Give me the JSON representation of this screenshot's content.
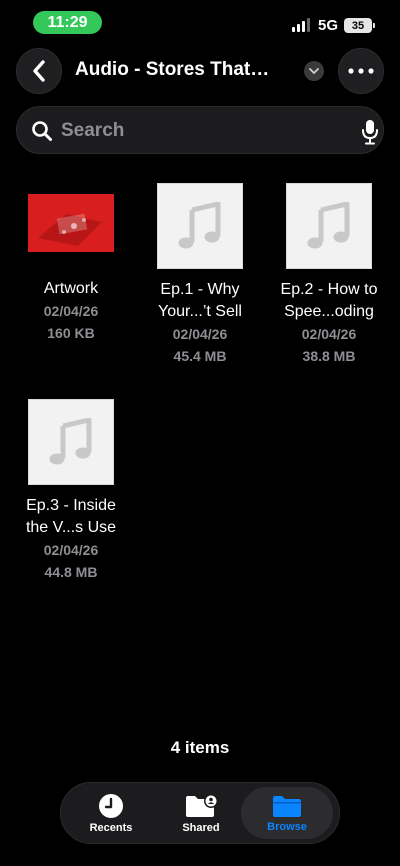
{
  "status": {
    "time": "11:29",
    "network": "5G",
    "battery": "35"
  },
  "nav": {
    "title": "Audio - Stores That…",
    "back_icon": "chevron-left-icon",
    "more_icon": "ellipsis-icon"
  },
  "search": {
    "placeholder": "Search"
  },
  "files": [
    {
      "name_line1": "Artwork",
      "name_line2": "",
      "date": "02/04/26",
      "size": "160 KB",
      "kind": "image"
    },
    {
      "name_line1": "Ep.1 - Why",
      "name_line2": "Your...’t Sell",
      "date": "02/04/26",
      "size": "45.4 MB",
      "kind": "audio"
    },
    {
      "name_line1": "Ep.2 - How to",
      "name_line2": "Spee...oding",
      "date": "02/04/26",
      "size": "38.8 MB",
      "kind": "audio"
    },
    {
      "name_line1": "Ep.3 - Inside",
      "name_line2": "the V...s Use",
      "date": "02/04/26",
      "size": "44.8 MB",
      "kind": "audio"
    }
  ],
  "items_count": "4 items",
  "tabs": [
    {
      "label": "Recents",
      "icon": "clock-icon"
    },
    {
      "label": "Shared",
      "icon": "shared-folder-icon"
    },
    {
      "label": "Browse",
      "icon": "folder-icon",
      "selected": true
    }
  ],
  "colors": {
    "accent": "#0a84ff",
    "time_pill": "#34c759",
    "artwork": "#d81e1e"
  }
}
